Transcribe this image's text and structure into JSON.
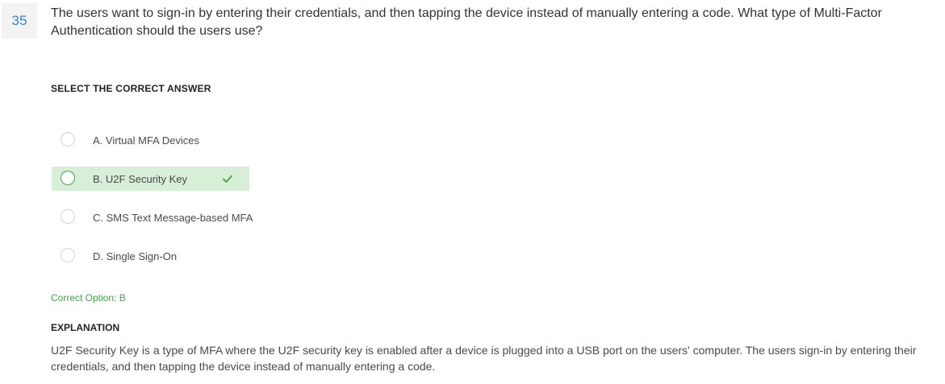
{
  "question": {
    "number": "35",
    "text": "The users want to sign-in by entering their credentials, and then tapping the device instead of manually entering a code. What type of Multi-Factor Authentication should the users use?"
  },
  "answers": {
    "heading": "SELECT THE CORRECT ANSWER",
    "options": [
      {
        "label": "A. Virtual MFA Devices"
      },
      {
        "label": "B. U2F Security Key"
      },
      {
        "label": "C. SMS Text Message-based MFA"
      },
      {
        "label": "D. Single Sign-On"
      }
    ]
  },
  "result": {
    "correct_option": "Correct Option: B"
  },
  "explanation": {
    "heading": "EXPLANATION",
    "text": "U2F Security Key is a type of MFA where the U2F security key is enabled after a device is plugged into a USB port on the users' computer. The users sign-in by entering their credentials, and then tapping the device instead of manually entering a code."
  },
  "colors": {
    "question_number": "#3a87c8",
    "correct_highlight": "#d6efd6",
    "correct_text": "#3fa745"
  },
  "icons": {
    "correct_mark": "check-icon",
    "option_selector": "radio-icon"
  }
}
